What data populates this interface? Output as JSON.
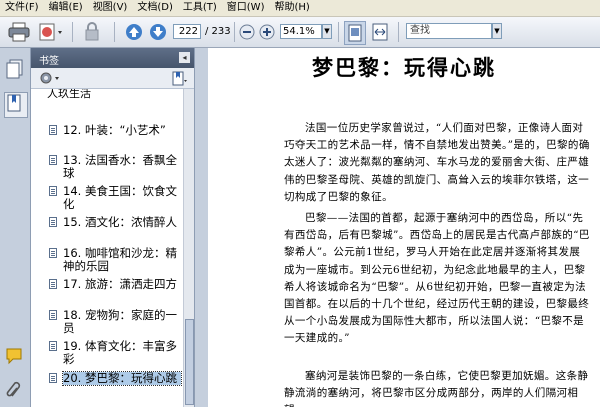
{
  "menu": [
    "文件(F)",
    "编辑(E)",
    "视图(V)",
    "文档(D)",
    "工具(T)",
    "窗口(W)",
    "帮助(H)"
  ],
  "toolbar": {
    "current_page": "222",
    "total_pages": "/ 233",
    "zoom": "54.1%",
    "search_placeholder": "查找"
  },
  "panel": {
    "title": "书签",
    "partial_item": "人玖生活",
    "bookmarks": [
      {
        "label": "12. 叶装：“小艺术”",
        "selected": false
      },
      {
        "label": "13. 法国香水：香飘全球",
        "selected": false
      },
      {
        "label": "14. 美食王国：饮食文化",
        "selected": false
      },
      {
        "label": "15. 酒文化：浓情醉人",
        "selected": false
      },
      {
        "label": "16. 咖啡馆和沙龙：精神的乐园",
        "selected": false
      },
      {
        "label": "17. 旅游：潇洒走四方",
        "selected": false
      },
      {
        "label": "18. 宠物狗：家庭的一员",
        "selected": false
      },
      {
        "label": "19. 体育文化：丰富多彩",
        "selected": false
      },
      {
        "label": "20. 梦巴黎：玩得心跳",
        "selected": true
      }
    ]
  },
  "document": {
    "title": "梦巴黎：玩得心跳",
    "paragraphs": [
      "法国一位历史学家曾说过，“人们面对巴黎，正像诗人面对巧夺天工的艺术品一样，情不自禁地发出赞美。”是的，巴黎的确太迷人了：波光粼粼的塞纳河、车水马龙的爱丽舍大街、庄严雄伟的巴黎圣母院、英雄的凯旋门、高耸入云的埃菲尔铁塔，这一切构成了巴黎的象征。",
      "巴黎——法国的首都，起源于塞纳河中的西岱岛，所以“先有西岱岛，后有巴黎城”。西岱岛上的居民是古代高卢部族的“巴黎希人”。公元前1世纪，罗马人开始在此定居并逐渐将其发展成为一座城市。到公元6世纪初，为纪念此地最早的主人，巴黎希人将该城命名为“巴黎”。从6世纪初开始，巴黎一直被定为法国首都。在以后的十几个世纪，经过历代王朝的建设，巴黎最终从一个小岛发展成为国际性大都市，所以法国人说：“巴黎不是一天建成的。”",
      "塞纳河是装饰巴黎的一条白练，它使巴黎更加妩媚。这条静静流淌的塞纳河，将巴黎市区分成两部分，两岸的人们隔河相望。"
    ]
  }
}
